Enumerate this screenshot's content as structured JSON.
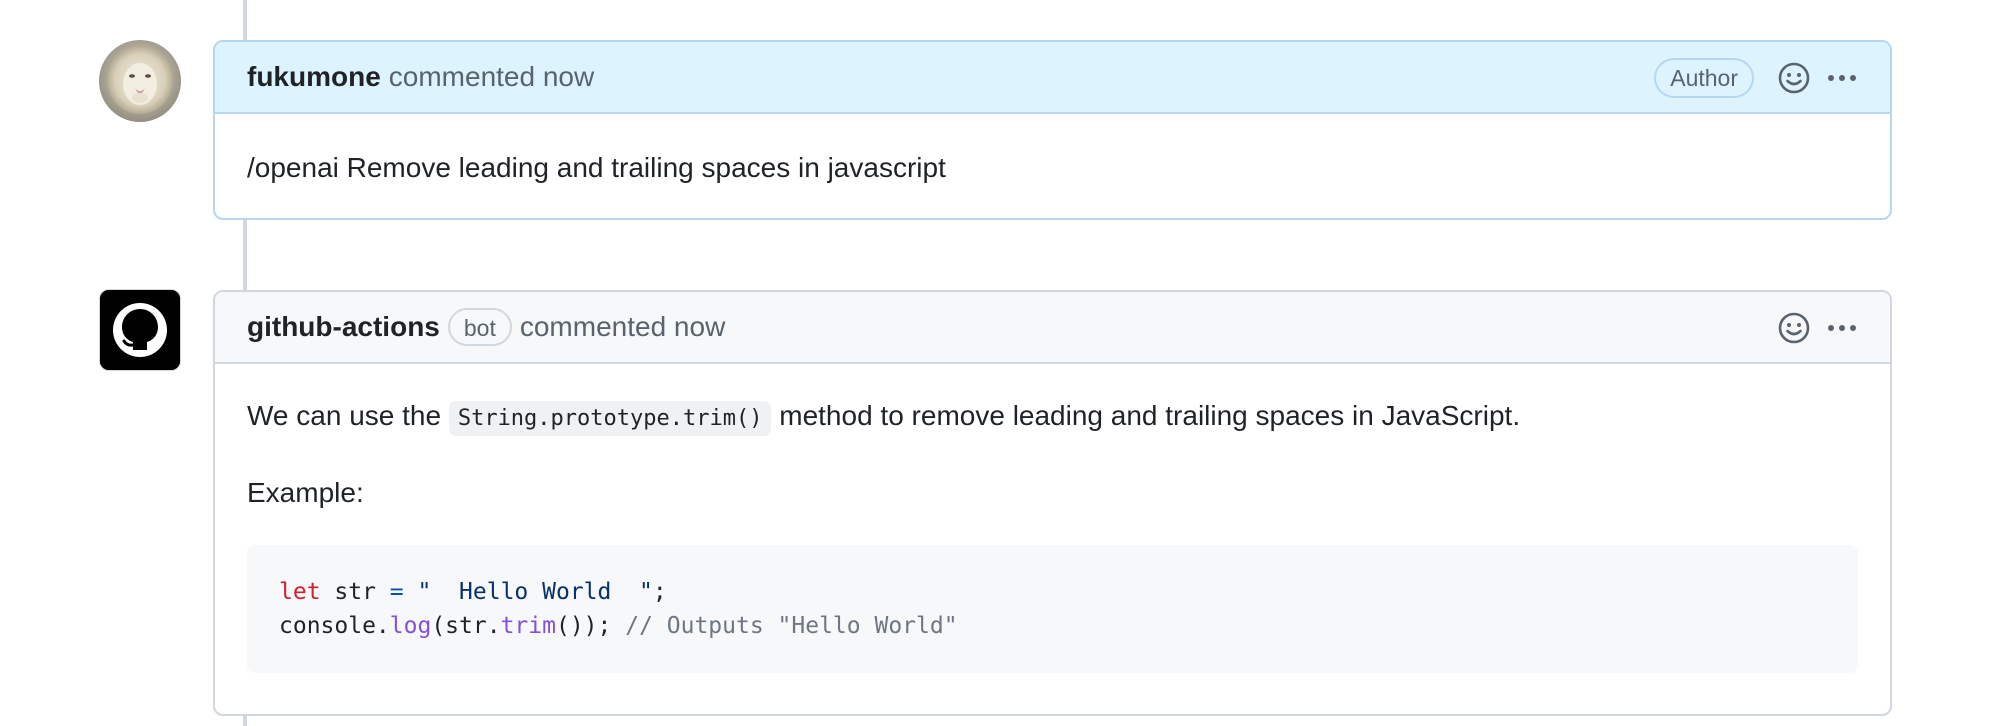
{
  "comments": [
    {
      "author": "fukumone",
      "action_text": "commented now",
      "badge": "Author",
      "body": "/openai Remove leading and trailing spaces in javascript",
      "is_author": true
    },
    {
      "author": "github-actions",
      "bot_label": "bot",
      "action_text": "commented now",
      "body": {
        "intro_before": "We can use the ",
        "intro_code": "String.prototype.trim()",
        "intro_after": " method to remove leading and trailing spaces in JavaScript.",
        "example_label": "Example:",
        "code": {
          "line1": {
            "kw": "let",
            "var": " str ",
            "op": "=",
            "str": " \"  Hello World  \"",
            "end": ";"
          },
          "line2": {
            "obj": "console.",
            "fn1": "log",
            "mid1": "(str.",
            "fn2": "trim",
            "mid2": "()); ",
            "comment": "// Outputs \"Hello World\""
          }
        }
      }
    }
  ],
  "icons": {
    "reaction": "smiley-icon",
    "menu": "kebab-horizontal-icon",
    "bot_avatar": "github-mark-icon",
    "user_avatar": "lion-avatar"
  },
  "colors": {
    "author_header_bg": "#ddf4ff",
    "author_border": "#b6d6f2",
    "header_bg": "#f6f8fa",
    "border": "#d0d7de",
    "code_bg": "#f6f8fa",
    "keyword": "#cf222e",
    "function": "#8250df",
    "string": "#0a3069",
    "comment": "#6e7781"
  }
}
